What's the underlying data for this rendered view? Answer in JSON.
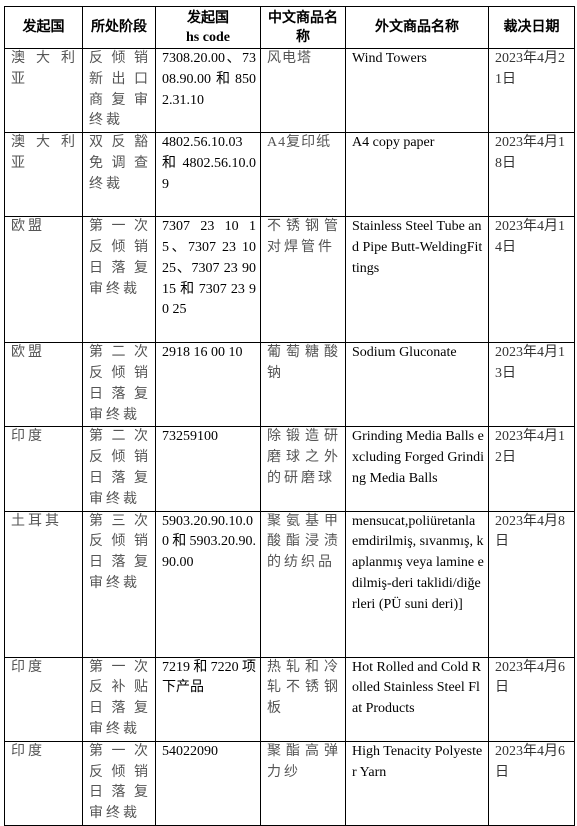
{
  "headers": {
    "country": "发起国",
    "stage": "所处阶段",
    "hs_code_line1": "发起国",
    "hs_code_line2": "hs code",
    "cn_name": "中文商品名称",
    "foreign_name": "外文商品名称",
    "date": "裁决日期"
  },
  "rows": [
    {
      "country": "澳大利亚",
      "stage": "反倾销新出口商复审终裁",
      "hs_code": "7308.20.00、7308.90.00和8502.31.10",
      "cn_name": "风电塔",
      "foreign_name": "Wind Towers",
      "date": "2023年4月21日"
    },
    {
      "country": "澳大利亚",
      "stage": "双反豁免调查终裁",
      "hs_code": "4802.56.10.03和4802.56.10.09",
      "cn_name": "A4复印纸",
      "foreign_name": "A4 copy paper",
      "date": "2023年4月18日"
    },
    {
      "country": "欧盟",
      "stage": "第一次反倾销日落复审终裁",
      "hs_code": "7307 23 10 15、7307 23 10 25、7307 23 90 15 和 7307 23 90 25",
      "cn_name": "不锈钢管对焊管件",
      "foreign_name": "Stainless Steel Tube and Pipe Butt-WeldingFittings",
      "date": "2023年4月14日"
    },
    {
      "country": "欧盟",
      "stage": "第二次反倾销日落复审终裁",
      "hs_code": "2918 16 00 10",
      "cn_name": "葡萄糖酸钠",
      "foreign_name": "Sodium Gluconate",
      "date": "2023年4月13日"
    },
    {
      "country": "印度",
      "stage": "第二次反倾销日落复审终裁",
      "hs_code": "73259100",
      "cn_name": "除锻造研磨球之外的研磨球",
      "foreign_name": "Grinding Media Balls excluding Forged Grinding Media Balls",
      "date": "2023年4月12日"
    },
    {
      "country": "土耳其",
      "stage": "第三次反倾销日落复审终裁",
      "hs_code": "5903.20.90.10.00和5903.20.90.90.00",
      "cn_name": "聚氨基甲酸酯浸渍的纺织品",
      "foreign_name": "mensucat,poliüretanla emdirilmiş, sıvanmış, kaplanmış veya lamine edilmiş-deri taklidi/diğerleri (PÜ suni deri)]",
      "date": "2023年4月8日"
    },
    {
      "country": "印度",
      "stage": "第一次反补贴日落复审终裁",
      "hs_code": "7219和7220项下产品",
      "cn_name": "热轧和冷轧不锈钢板",
      "foreign_name": "Hot Rolled and Cold Rolled Stainless Steel Flat Products",
      "date": "2023年4月6日"
    },
    {
      "country": "印度",
      "stage": "第一次反倾销日落复审终裁",
      "hs_code": "54022090",
      "cn_name": "聚酯高弹力纱",
      "foreign_name": "High Tenacity Polyester Yarn",
      "date": "2023年4月6日"
    }
  ]
}
